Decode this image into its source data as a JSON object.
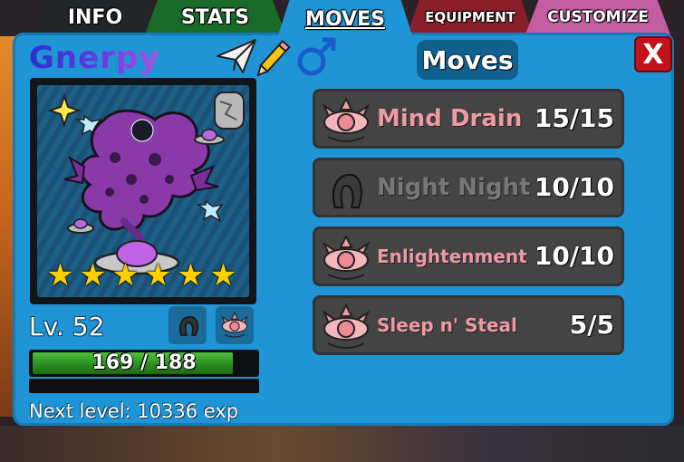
{
  "tabs": [
    {
      "label": "INFO"
    },
    {
      "label": "STATS"
    },
    {
      "label": "MOVES",
      "active": true
    },
    {
      "label": "EQUIPMENT"
    },
    {
      "label": "CUSTOMIZE"
    }
  ],
  "creature": {
    "name": "Gnerpy",
    "stars": 6,
    "level_label": "Lv. 52",
    "hp": {
      "current": 169,
      "max": 188,
      "text": "169 / 188"
    },
    "next_level_text": "Next level: 10336 exp"
  },
  "panel": {
    "heading": "Moves",
    "close_label": "X"
  },
  "moves": [
    {
      "name": "Mind Drain",
      "pp": "15/15",
      "icon": "psychic-eye-icon",
      "color": "#ee9aa2"
    },
    {
      "name": "Night Night",
      "pp": "10/10",
      "icon": "dark-claw-icon",
      "color": "#777777"
    },
    {
      "name": "Enlightenment",
      "pp": "10/10",
      "icon": "psychic-eye-icon",
      "color": "#ee9aa2"
    },
    {
      "name": "Sleep n' Steal",
      "pp": "5/5",
      "icon": "psychic-eye-icon",
      "color": "#ee9aa2"
    }
  ],
  "colors": {
    "panel": "#1f95d6",
    "psychic": "#ee9aa2",
    "dark": "#777777",
    "hp_bar": "#2a8a20",
    "close": "#c0121a"
  }
}
